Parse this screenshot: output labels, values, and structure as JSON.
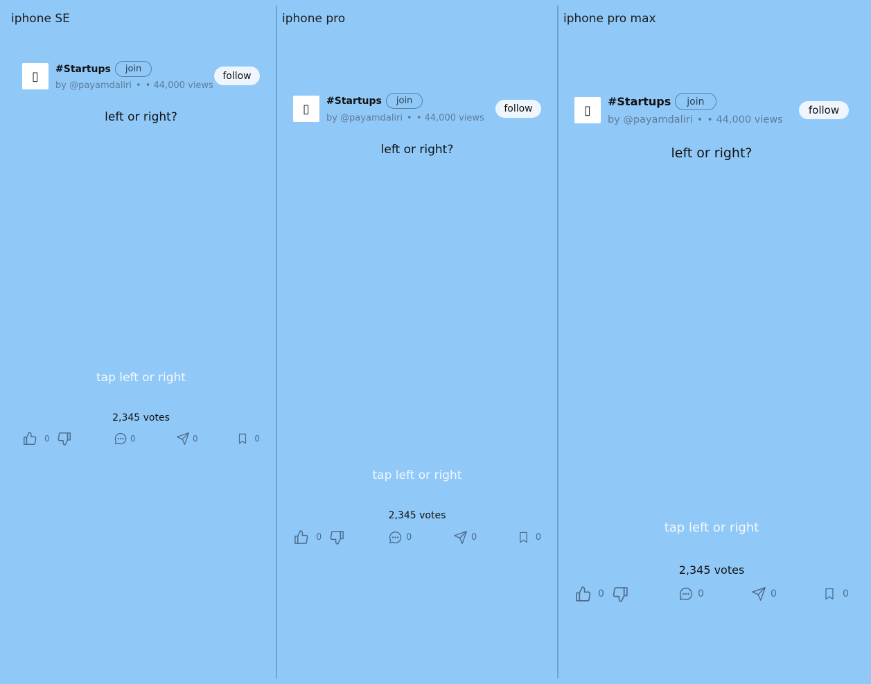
{
  "columns": [
    {
      "title": "iphone SE",
      "post": {
        "avatar_icon": "app-icon-placeholder",
        "tag": "#Startups",
        "join_label": "join",
        "author": "by @payamdaliri",
        "bullet": "•",
        "views": "• 44,000 views",
        "follow_label": "follow",
        "question": "left or right?",
        "tap_hint": "tap left or right",
        "votes": "2,345 votes",
        "likes": "0",
        "comments": "0",
        "shares": "0",
        "saves": "0"
      }
    },
    {
      "title": "iphone pro",
      "post": {
        "avatar_icon": "app-icon-placeholder",
        "tag": "#Startups",
        "join_label": "join",
        "author": "by @payamdaliri",
        "bullet": "•",
        "views": "• 44,000 views",
        "follow_label": "follow",
        "question": "left or right?",
        "tap_hint": "tap left or right",
        "votes": "2,345 votes",
        "likes": "0",
        "comments": "0",
        "shares": "0",
        "saves": "0"
      }
    },
    {
      "title": "iphone pro max",
      "post": {
        "avatar_icon": "app-icon-placeholder",
        "tag": "#Startups",
        "join_label": "join",
        "author": "by @payamdaliri",
        "bullet": "•",
        "views": "• 44,000 views",
        "follow_label": "follow",
        "question": "left or right?",
        "tap_hint": "tap left or right",
        "votes": "2,345 votes",
        "likes": "0",
        "comments": "0",
        "shares": "0",
        "saves": "0"
      }
    }
  ],
  "colors": {
    "background": "#90c9f8",
    "divider": "#6ea3d6",
    "hint_text": "#f3f8fd",
    "icon": "#4d6c8c"
  }
}
